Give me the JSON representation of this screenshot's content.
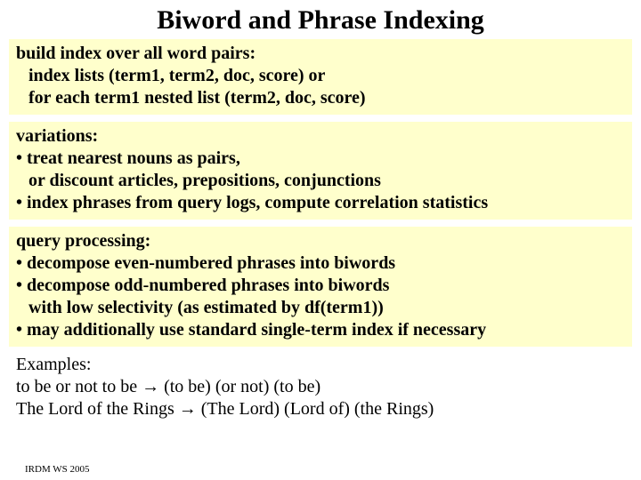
{
  "title": "Biword and Phrase Indexing",
  "block1": {
    "line1": "build index over all word pairs:",
    "line2": "index lists (term1, term2, doc, score) or",
    "line3": "for each term1 nested list (term2, doc, score)"
  },
  "block2": {
    "line1": "variations:",
    "line2": "• treat nearest nouns as pairs,",
    "line3": "or discount articles, prepositions, conjunctions",
    "line4": "• index phrases from query logs, compute correlation statistics"
  },
  "block3": {
    "line1": "query processing:",
    "line2": "• decompose even-numbered phrases into biwords",
    "line3": "• decompose odd-numbered phrases into biwords",
    "line4": "with low selectivity (as estimated by df(term1))",
    "line5": "• may additionally use standard single-term index if necessary"
  },
  "examples": {
    "label": "Examples:",
    "line1": "to be or not to be → (to be) (or not) (to be)",
    "line2": "The Lord of the Rings → (The Lord) (Lord of) (the Rings)"
  },
  "footer": "IRDM  WS 2005"
}
